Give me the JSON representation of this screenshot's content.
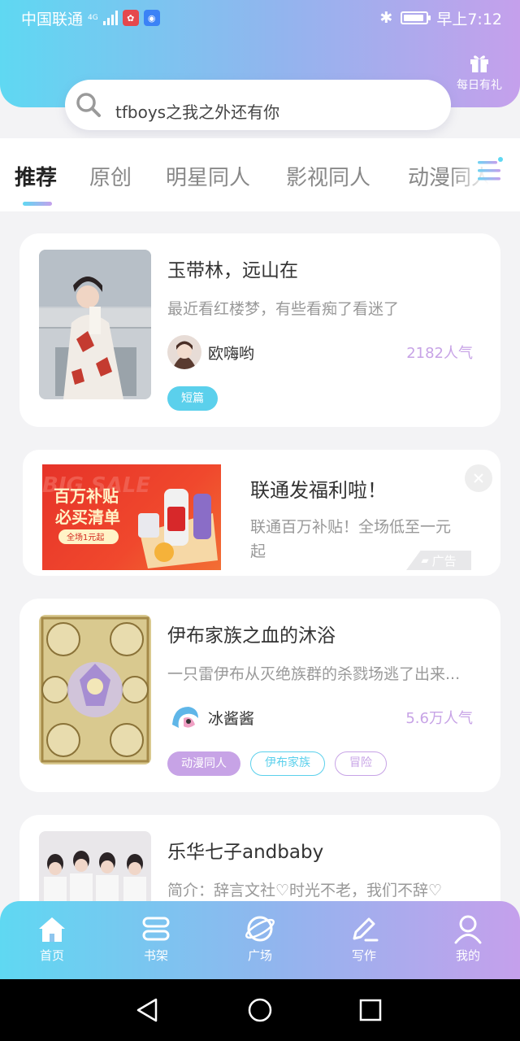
{
  "status_bar": {
    "carrier": "中国联通",
    "network": "4G",
    "time": "早上7:12"
  },
  "header": {
    "gift_label": "每日有礼",
    "search_text": "tfboys之我之外还有你"
  },
  "tabs": [
    {
      "label": "推荐",
      "active": true
    },
    {
      "label": "原创",
      "active": false
    },
    {
      "label": "明星同人",
      "active": false
    },
    {
      "label": "影视同人",
      "active": false
    },
    {
      "label": "动漫同人",
      "active": false
    }
  ],
  "feed": [
    {
      "title": "玉带林，远山在",
      "desc": "最近看红楼梦，有些看痴了看迷了",
      "author": "欧嗨哟",
      "popularity": "2182人气",
      "tags": [
        "短篇"
      ]
    },
    {
      "title": "伊布家族之血的沐浴",
      "desc": "一只雷伊布从灭绝族群的杀戮场逃了出来...",
      "author": "冰酱酱",
      "popularity": "5.6万人气",
      "tags": [
        "动漫同人",
        "伊布家族",
        "冒险"
      ]
    },
    {
      "title": "乐华七子andbaby",
      "desc": "简介：辞言文社♡时光不老，我们不辞♡"
    }
  ],
  "ad": {
    "title": "联通发福利啦！",
    "desc": "联通百万补贴！全场低至一元起",
    "badge": "广告",
    "image_text": {
      "line1": "百万补贴",
      "line2": "必买清单",
      "price": "全场1元起",
      "bg_text": "BIG SALE"
    }
  },
  "bottom_nav": [
    {
      "label": "首页",
      "icon": "home-icon"
    },
    {
      "label": "书架",
      "icon": "bookshelf-icon"
    },
    {
      "label": "广场",
      "icon": "planet-icon"
    },
    {
      "label": "写作",
      "icon": "pen-icon"
    },
    {
      "label": "我的",
      "icon": "user-icon"
    }
  ],
  "colors": {
    "gradient_start": "#5fd8f2",
    "gradient_end": "#c5a0ec",
    "accent_purple": "#c7a3e6",
    "accent_cyan": "#5bd0ec"
  }
}
